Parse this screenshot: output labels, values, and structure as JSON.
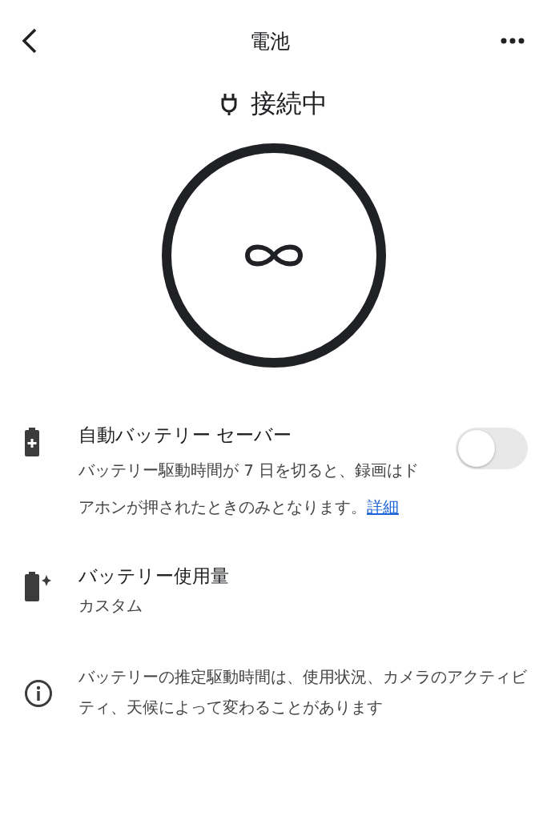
{
  "header": {
    "title": "電池"
  },
  "status": {
    "label": "接続中"
  },
  "battery_saver": {
    "title": "自動バッテリー セーバー",
    "description": "バッテリー駆動時間が 7 日を切ると、録画はドアホンが押されたときのみとなります。",
    "link": "詳細",
    "on": false
  },
  "battery_usage": {
    "title": "バッテリー使用量",
    "value": "カスタム"
  },
  "info": {
    "text": "バッテリーの推定駆動時間は、使用状況、カメラのアクティビティ、天候によって変わることがあります"
  }
}
